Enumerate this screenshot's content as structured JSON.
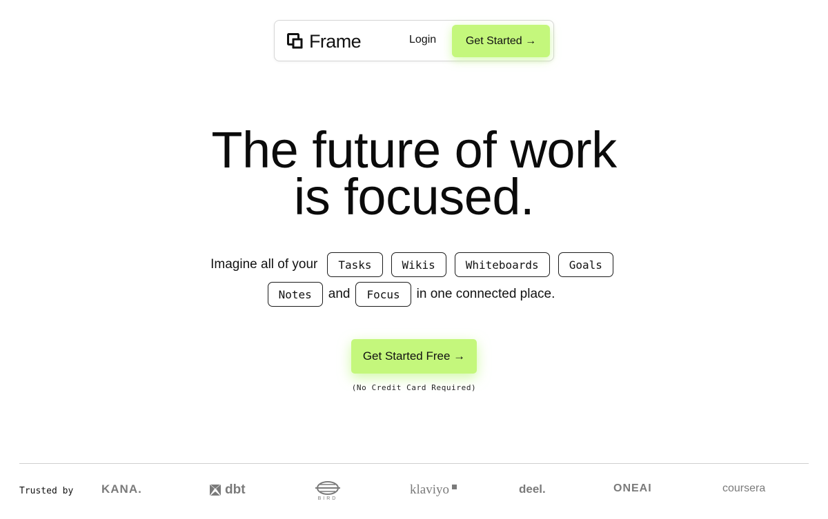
{
  "nav": {
    "logo_text": "Frame",
    "login_label": "Login",
    "cta_label": "Get Started →"
  },
  "hero": {
    "title_line_1": "The future of work",
    "title_line_2": "is focused.",
    "lead_text": "Imagine all of your",
    "chips_row_1": [
      "Tasks",
      "Wikis",
      "Whiteboards",
      "Goals"
    ],
    "chip_notes": "Notes",
    "connector": "and",
    "chip_focus": "Focus",
    "trail_text": "in one connected place.",
    "cta_label": "Get Started Free →",
    "cta_note": "(No Credit Card Required)"
  },
  "trusted": {
    "label": "Trusted by",
    "brands": [
      "KANA.",
      "dbt",
      "BIRD",
      "klaviyo",
      "deel.",
      "ONEAI",
      "coursera"
    ]
  },
  "colors": {
    "accent": "#c4f77c",
    "text": "#111111",
    "brand_gray": "#7a7a7a",
    "border": "#d6d6d6"
  }
}
